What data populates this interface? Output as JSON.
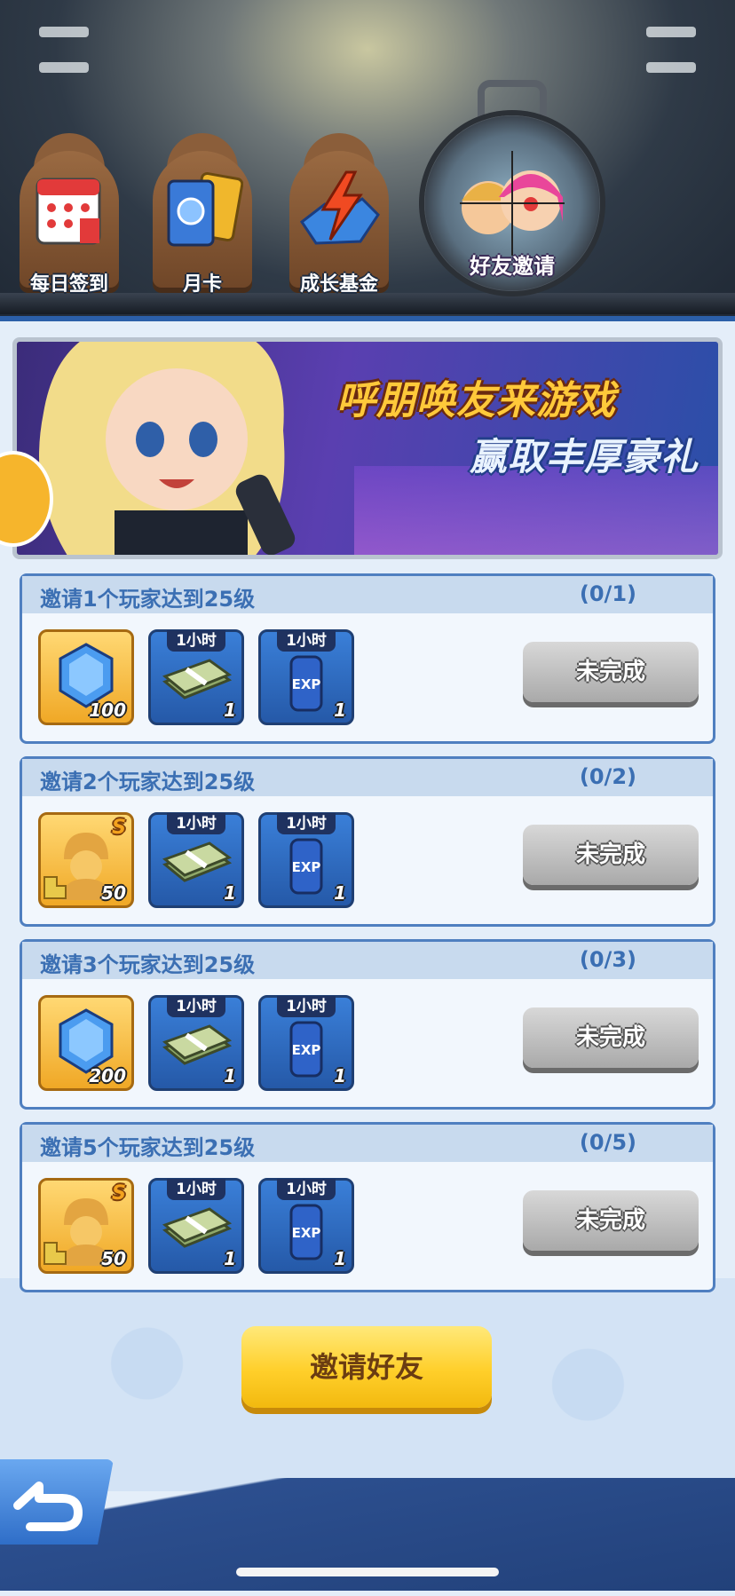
{
  "tabs": [
    {
      "label": "每日签到",
      "icon": "calendar-icon"
    },
    {
      "label": "月卡",
      "icon": "card-icon"
    },
    {
      "label": "成长基金",
      "icon": "lightning-crystal-icon"
    },
    {
      "label": "好友邀请",
      "icon": "scope-friends-icon",
      "selected": true
    }
  ],
  "banner": {
    "line1": "呼朋唤友来游戏",
    "line2": "赢取丰厚豪礼"
  },
  "tasks": [
    {
      "title": "邀请1个玩家达到25级",
      "progress": "(0/1)",
      "rewards": [
        {
          "icon": "gem-icon",
          "qty": "100"
        },
        {
          "icon": "cash-icon",
          "tag": "1小时",
          "qty": "1"
        },
        {
          "icon": "exp-can-icon",
          "tag": "1小时",
          "qty": "1"
        }
      ],
      "status": "未完成"
    },
    {
      "title": "邀请2个玩家达到25级",
      "progress": "(0/2)",
      "rewards": [
        {
          "icon": "soldier-fragment-icon",
          "rank": "S",
          "qty": "50"
        },
        {
          "icon": "cash-icon",
          "tag": "1小时",
          "qty": "1"
        },
        {
          "icon": "exp-can-icon",
          "tag": "1小时",
          "qty": "1"
        }
      ],
      "status": "未完成"
    },
    {
      "title": "邀请3个玩家达到25级",
      "progress": "(0/3)",
      "rewards": [
        {
          "icon": "gem-icon",
          "qty": "200"
        },
        {
          "icon": "cash-icon",
          "tag": "1小时",
          "qty": "1"
        },
        {
          "icon": "exp-can-icon",
          "tag": "1小时",
          "qty": "1"
        }
      ],
      "status": "未完成"
    },
    {
      "title": "邀请5个玩家达到25级",
      "progress": "(0/5)",
      "rewards": [
        {
          "icon": "soldier-fragment-icon",
          "rank": "S",
          "qty": "50"
        },
        {
          "icon": "cash-icon",
          "tag": "1小时",
          "qty": "1"
        },
        {
          "icon": "exp-can-icon",
          "tag": "1小时",
          "qty": "1"
        }
      ],
      "status": "未完成"
    }
  ],
  "invite_button": "邀请好友",
  "back_button_icon": "back-arrow-icon"
}
